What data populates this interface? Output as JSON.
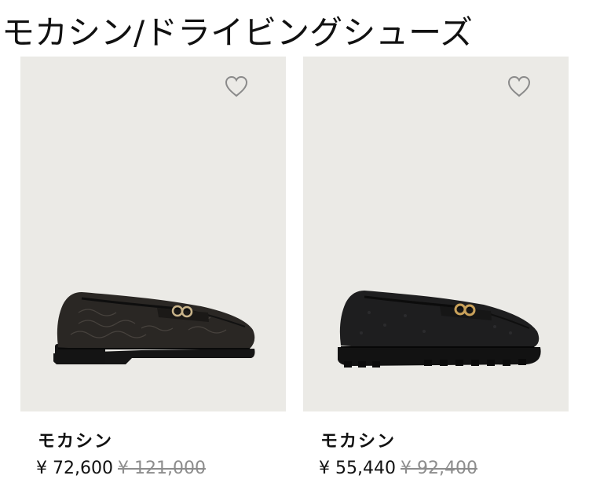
{
  "page": {
    "title": "モカシン/ドライビングシューズ"
  },
  "products": [
    {
      "name": "モカシン",
      "price": "¥ 72,600",
      "original_price": "¥ 121,000",
      "favorite_icon": "heart-outline-icon",
      "image_subject": "loafer-shoe-image"
    },
    {
      "name": "モカシン",
      "price": "¥ 55,440",
      "original_price": "¥ 92,400",
      "favorite_icon": "heart-outline-icon",
      "image_subject": "loafer-shoe-image"
    }
  ],
  "colors": {
    "card_background": "#ebeae6",
    "text": "#111111",
    "strikethrough_price": "#8d8d8d",
    "icon": "#8a8a8a"
  }
}
